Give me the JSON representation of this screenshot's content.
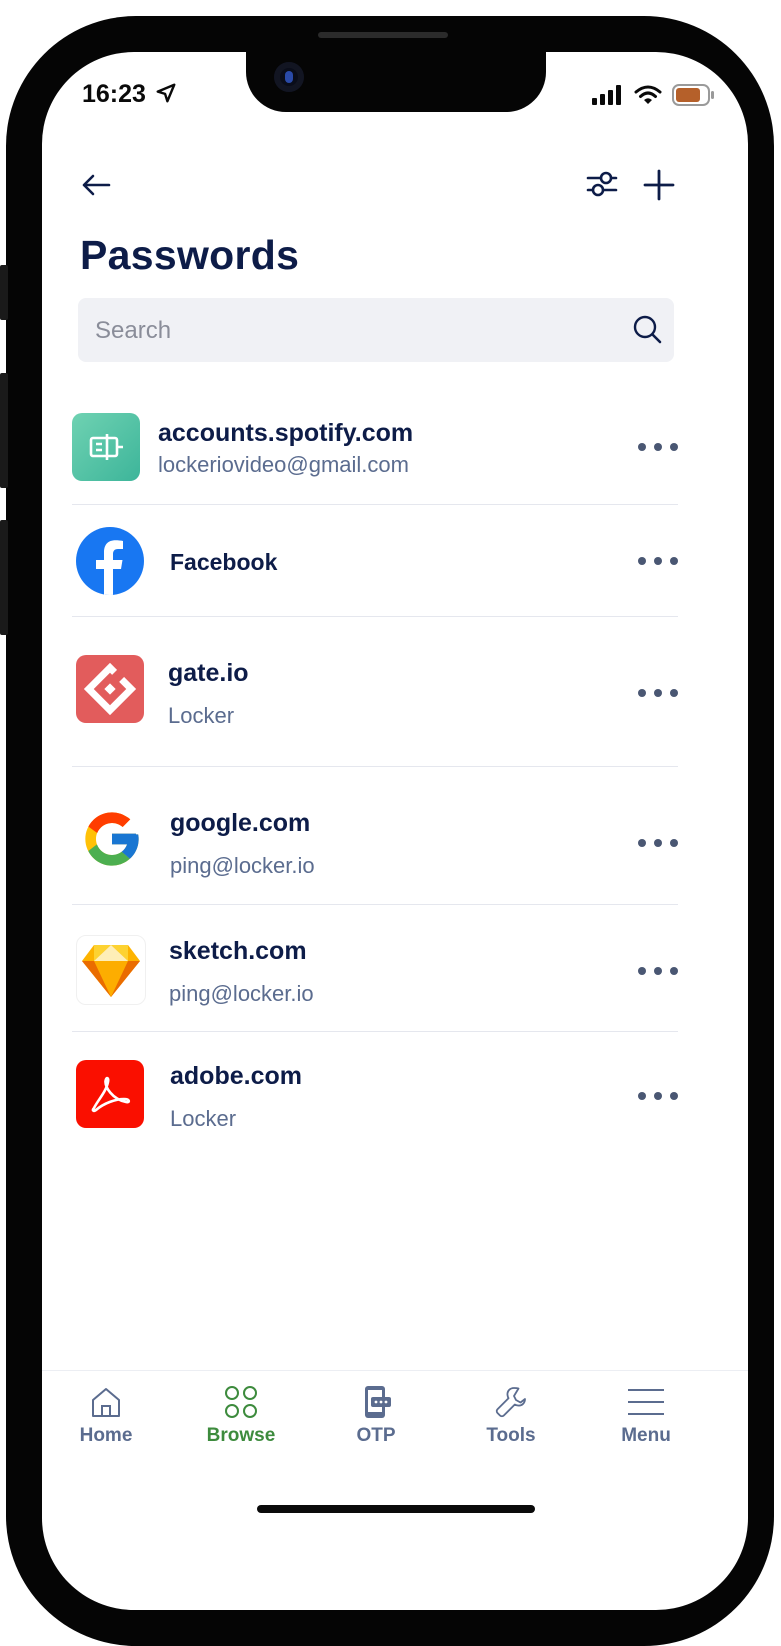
{
  "status_bar": {
    "time": "16:23"
  },
  "header": {
    "title": "Passwords"
  },
  "search": {
    "placeholder": "Search"
  },
  "items": [
    {
      "name": "accounts.spotify.com",
      "sub": "lockeriovideo@gmail.com",
      "icon": "spotify-app-icon"
    },
    {
      "name": "Facebook",
      "sub": "",
      "icon": "facebook-icon"
    },
    {
      "name": "gate.io",
      "sub": "Locker",
      "icon": "gateio-icon"
    },
    {
      "name": "google.com",
      "sub": "ping@locker.io",
      "icon": "google-icon"
    },
    {
      "name": "sketch.com",
      "sub": "ping@locker.io",
      "icon": "sketch-icon"
    },
    {
      "name": "adobe.com",
      "sub": "Locker",
      "icon": "adobe-icon"
    }
  ],
  "tabs": [
    {
      "label": "Home",
      "icon": "home-icon",
      "active": false
    },
    {
      "label": "Browse",
      "icon": "browse-grid-icon",
      "active": true
    },
    {
      "label": "OTP",
      "icon": "otp-phone-icon",
      "active": false
    },
    {
      "label": "Tools",
      "icon": "wrench-icon",
      "active": false
    },
    {
      "label": "Menu",
      "icon": "menu-icon",
      "active": false
    }
  ],
  "colors": {
    "title": "#0d1c48",
    "subtext": "#5b6c8f",
    "active_tab": "#3d8b3d",
    "search_bg": "#f0f1f5"
  }
}
